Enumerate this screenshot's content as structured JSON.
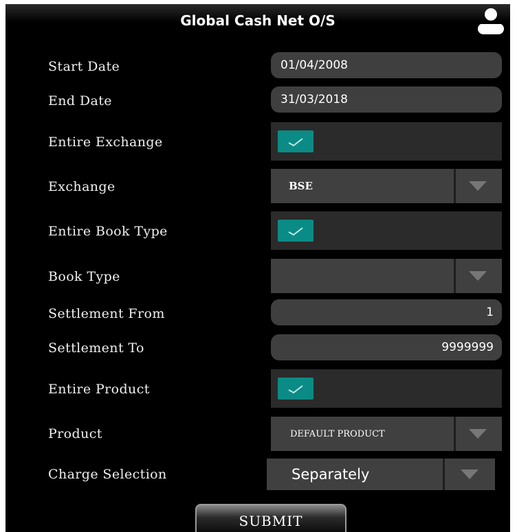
{
  "header": {
    "title": "Global Cash Net O/S",
    "user_icon": "user-icon"
  },
  "form": {
    "start_date": {
      "label": "Start Date",
      "value": "01/04/2008"
    },
    "end_date": {
      "label": "End Date",
      "value": "31/03/2018"
    },
    "entire_exchange": {
      "label": "Entire Exchange",
      "checked": true
    },
    "exchange": {
      "label": "Exchange",
      "value": "BSE"
    },
    "entire_book_type": {
      "label": "Entire Book Type",
      "checked": true
    },
    "book_type": {
      "label": "Book Type",
      "value": ""
    },
    "settlement_from": {
      "label": "Settlement From",
      "value": "1"
    },
    "settlement_to": {
      "label": "Settlement To",
      "value": "9999999"
    },
    "entire_product": {
      "label": "Entire Product",
      "checked": true
    },
    "product": {
      "label": "Product",
      "value": "DEFAULT PRODUCT"
    },
    "charge_selection": {
      "label": "Charge Selection",
      "value": "Separately"
    }
  },
  "actions": {
    "submit_label": "SUBMIT"
  },
  "colors": {
    "background": "#000000",
    "field": "#3f3f3f",
    "checkbox": "#0b8b85",
    "text": "#ffffff"
  }
}
